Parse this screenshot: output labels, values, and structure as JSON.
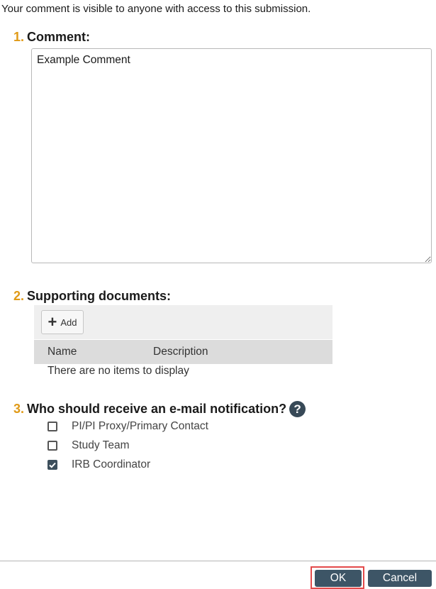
{
  "intro_text": "Your comment is visible to anyone with access to this submission.",
  "comment": {
    "number": "1.",
    "label": "Comment:",
    "value": "Example Comment"
  },
  "documents": {
    "number": "2.",
    "label": "Supporting documents:",
    "add_label": "Add",
    "columns": [
      "Name",
      "Description"
    ],
    "empty_text": "There are no items to display"
  },
  "notification": {
    "number": "3.",
    "label": "Who should receive an e-mail notification?",
    "help_glyph": "?",
    "options": [
      {
        "label": "PI/PI Proxy/Primary Contact",
        "checked": false
      },
      {
        "label": "Study Team",
        "checked": false
      },
      {
        "label": "IRB Coordinator",
        "checked": true
      }
    ]
  },
  "footer": {
    "ok_label": "OK",
    "cancel_label": "Cancel"
  }
}
